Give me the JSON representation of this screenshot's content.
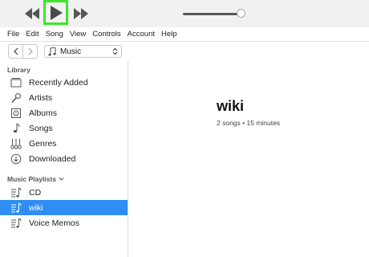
{
  "transport": {
    "rewind_icon": "rewind-icon",
    "play_icon": "play-icon",
    "fast_forward_icon": "fast-forward-icon",
    "volume_level": 1.0,
    "highlight_color": "#3ee62b"
  },
  "menu": [
    "File",
    "Edit",
    "Song",
    "View",
    "Controls",
    "Account",
    "Help"
  ],
  "nav": {
    "back_icon": "chevron-left-icon",
    "forward_icon": "chevron-right-icon",
    "media_type": "Music",
    "media_icon": "music-note-icon"
  },
  "sidebar": {
    "library_header": "Library",
    "library_items": [
      {
        "label": "Recently Added",
        "icon": "recently-added-icon"
      },
      {
        "label": "Artists",
        "icon": "microphone-icon"
      },
      {
        "label": "Albums",
        "icon": "album-icon"
      },
      {
        "label": "Songs",
        "icon": "music-note-icon"
      },
      {
        "label": "Genres",
        "icon": "genres-icon"
      },
      {
        "label": "Downloaded",
        "icon": "download-icon"
      }
    ],
    "playlists_header": "Music Playlists",
    "playlists": [
      {
        "label": "CD",
        "icon": "playlist-icon",
        "selected": false
      },
      {
        "label": "wiki",
        "icon": "playlist-icon",
        "selected": true
      },
      {
        "label": "Voice Memos",
        "icon": "playlist-icon",
        "selected": false
      }
    ],
    "selected_color": "#2f8df3"
  },
  "main": {
    "title": "wiki",
    "subtitle": "2 songs • 15 minutes"
  }
}
